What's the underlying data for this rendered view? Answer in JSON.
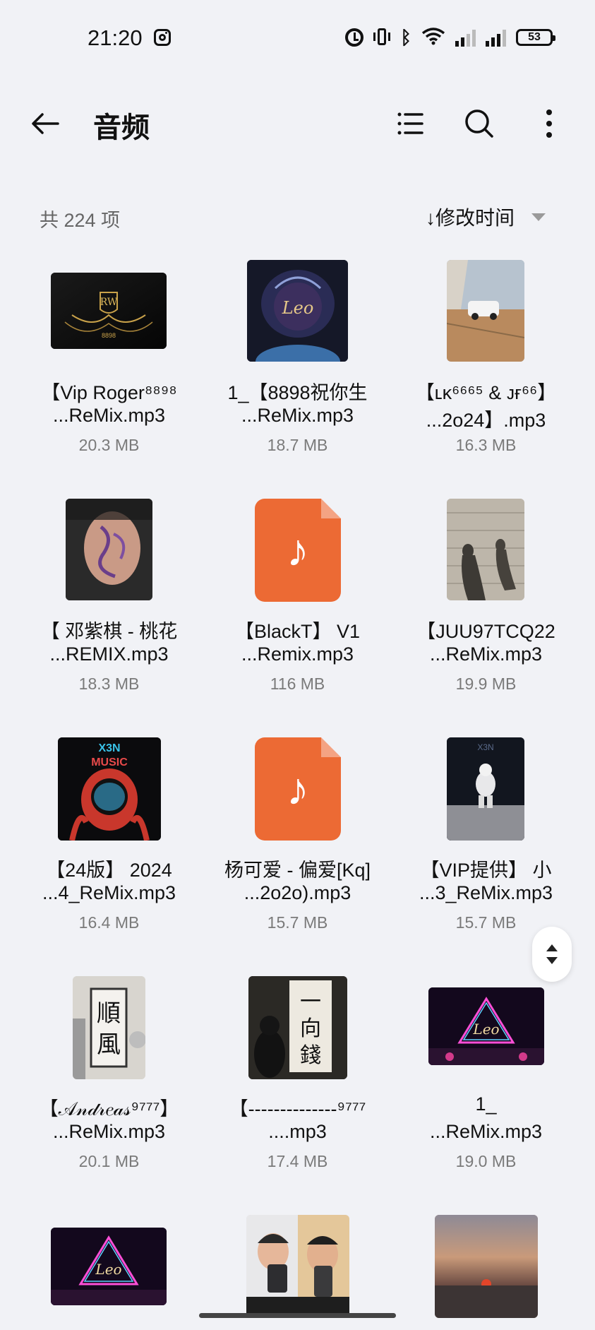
{
  "status": {
    "time": "21:20",
    "battery": "53"
  },
  "header": {
    "title": "音频"
  },
  "list": {
    "count_label": "共 224 项",
    "sort_label": "↓修改时间"
  },
  "files": [
    {
      "line1": "【Vip Roger⁸⁸⁹⁸",
      "line2": "...ReMix.mp3",
      "size": "20.3 MB",
      "thumb": "rw-vip"
    },
    {
      "line1": "1_【8898祝你生",
      "line2": "...ReMix.mp3",
      "size": "18.7 MB",
      "thumb": "lion"
    },
    {
      "line1": "【ʟᴋ⁶⁶⁶⁵ & ᴊғ⁶⁶】",
      "line2": "...2o24】.mp3",
      "size": "16.3 MB",
      "thumb": "street"
    },
    {
      "line1": "【 邓紫棋 - 桃花",
      "line2": "...REMIX.mp3",
      "size": "18.3 MB",
      "thumb": "face"
    },
    {
      "line1": "【BlackT】 V1",
      "line2": "...Remix.mp3",
      "size": "116 MB",
      "thumb": "music-file-icon"
    },
    {
      "line1": "【JUU97TCQ22",
      "line2": "...ReMix.mp3",
      "size": "19.9 MB",
      "thumb": "shadows"
    },
    {
      "line1": "【24版】 2024",
      "line2": "...4_ReMix.mp3",
      "size": "16.4 MB",
      "thumb": "astronaut"
    },
    {
      "line1": "杨可爱 - 偏爱[Kq]",
      "line2": "...2o2o).mp3",
      "size": "15.7 MB",
      "thumb": "music-file-icon"
    },
    {
      "line1": "【VIP提供】 小",
      "line2": "...3_ReMix.mp3",
      "size": "15.7 MB",
      "thumb": "moon"
    },
    {
      "line1": "【𝒜𝓃𝒹𝓇𝑒𝒶𝓈⁹⁷⁷⁷】",
      "line2": "...ReMix.mp3",
      "size": "20.1 MB",
      "thumb": "calligraphy"
    },
    {
      "line1": "【--------------⁹⁷⁷⁷",
      "line2": "....mp3",
      "size": "17.4 MB",
      "thumb": "bear"
    },
    {
      "line1": "1_",
      "line2": "...ReMix.mp3",
      "size": "19.0 MB",
      "thumb": "leo-neon"
    },
    {
      "line1": "",
      "line2": "",
      "size": "",
      "thumb": "leo-neon-2"
    },
    {
      "line1": "",
      "line2": "",
      "size": "",
      "thumb": "selfie"
    },
    {
      "line1": "",
      "line2": "",
      "size": "",
      "thumb": "sunset"
    }
  ]
}
